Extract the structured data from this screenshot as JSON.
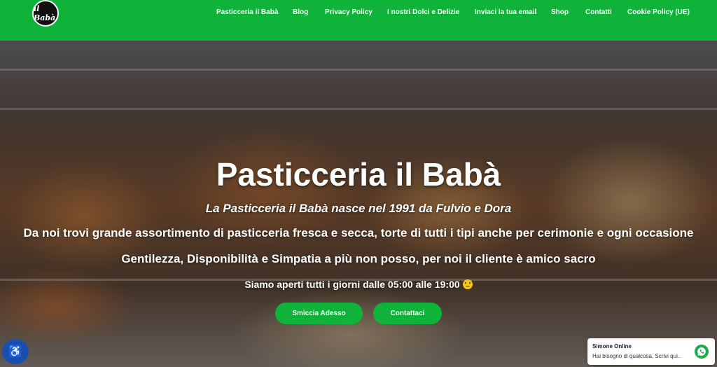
{
  "header": {
    "logo_text": "il Babà",
    "nav": [
      {
        "label": "Pasticceria il Babà"
      },
      {
        "label": "Blog"
      },
      {
        "label": "Privacy Policy"
      },
      {
        "label": "I nostri Dolci e Delizie"
      },
      {
        "label": "Inviaci la tua email"
      },
      {
        "label": "Shop"
      },
      {
        "label": "Contatti"
      },
      {
        "label": "Cookie Policy (UE)"
      }
    ]
  },
  "hero": {
    "title": "Pasticceria il Babà",
    "subtitle": "La Pasticceria il Babà nasce nel 1991 da Fulvio e Dora",
    "line1": "Da noi trovi grande assortimento di pasticceria fresca e secca, torte di tutti i tipi anche per cerimonie e ogni occasione",
    "line2": "Gentilezza, Disponibilità e Simpatia a più non posso, per noi il cliente è amico sacro",
    "hours": "Siamo aperti tutti i giorni dalle 05:00 alle 19:00",
    "btn_shop": "Smiccia Adesso",
    "btn_contact": "Contattaci"
  },
  "chat": {
    "name": "Simone Online",
    "message": "Hai bisogno di qualcosa, Scrivi qui.."
  },
  "colors": {
    "brand_green": "#0fb33a",
    "accessibility_blue": "#1a4fb0",
    "whatsapp_green": "#1faa4b"
  },
  "icons": {
    "accessibility": "accessibility-icon",
    "whatsapp": "whatsapp-icon",
    "smile": "smile-emoji-icon"
  }
}
